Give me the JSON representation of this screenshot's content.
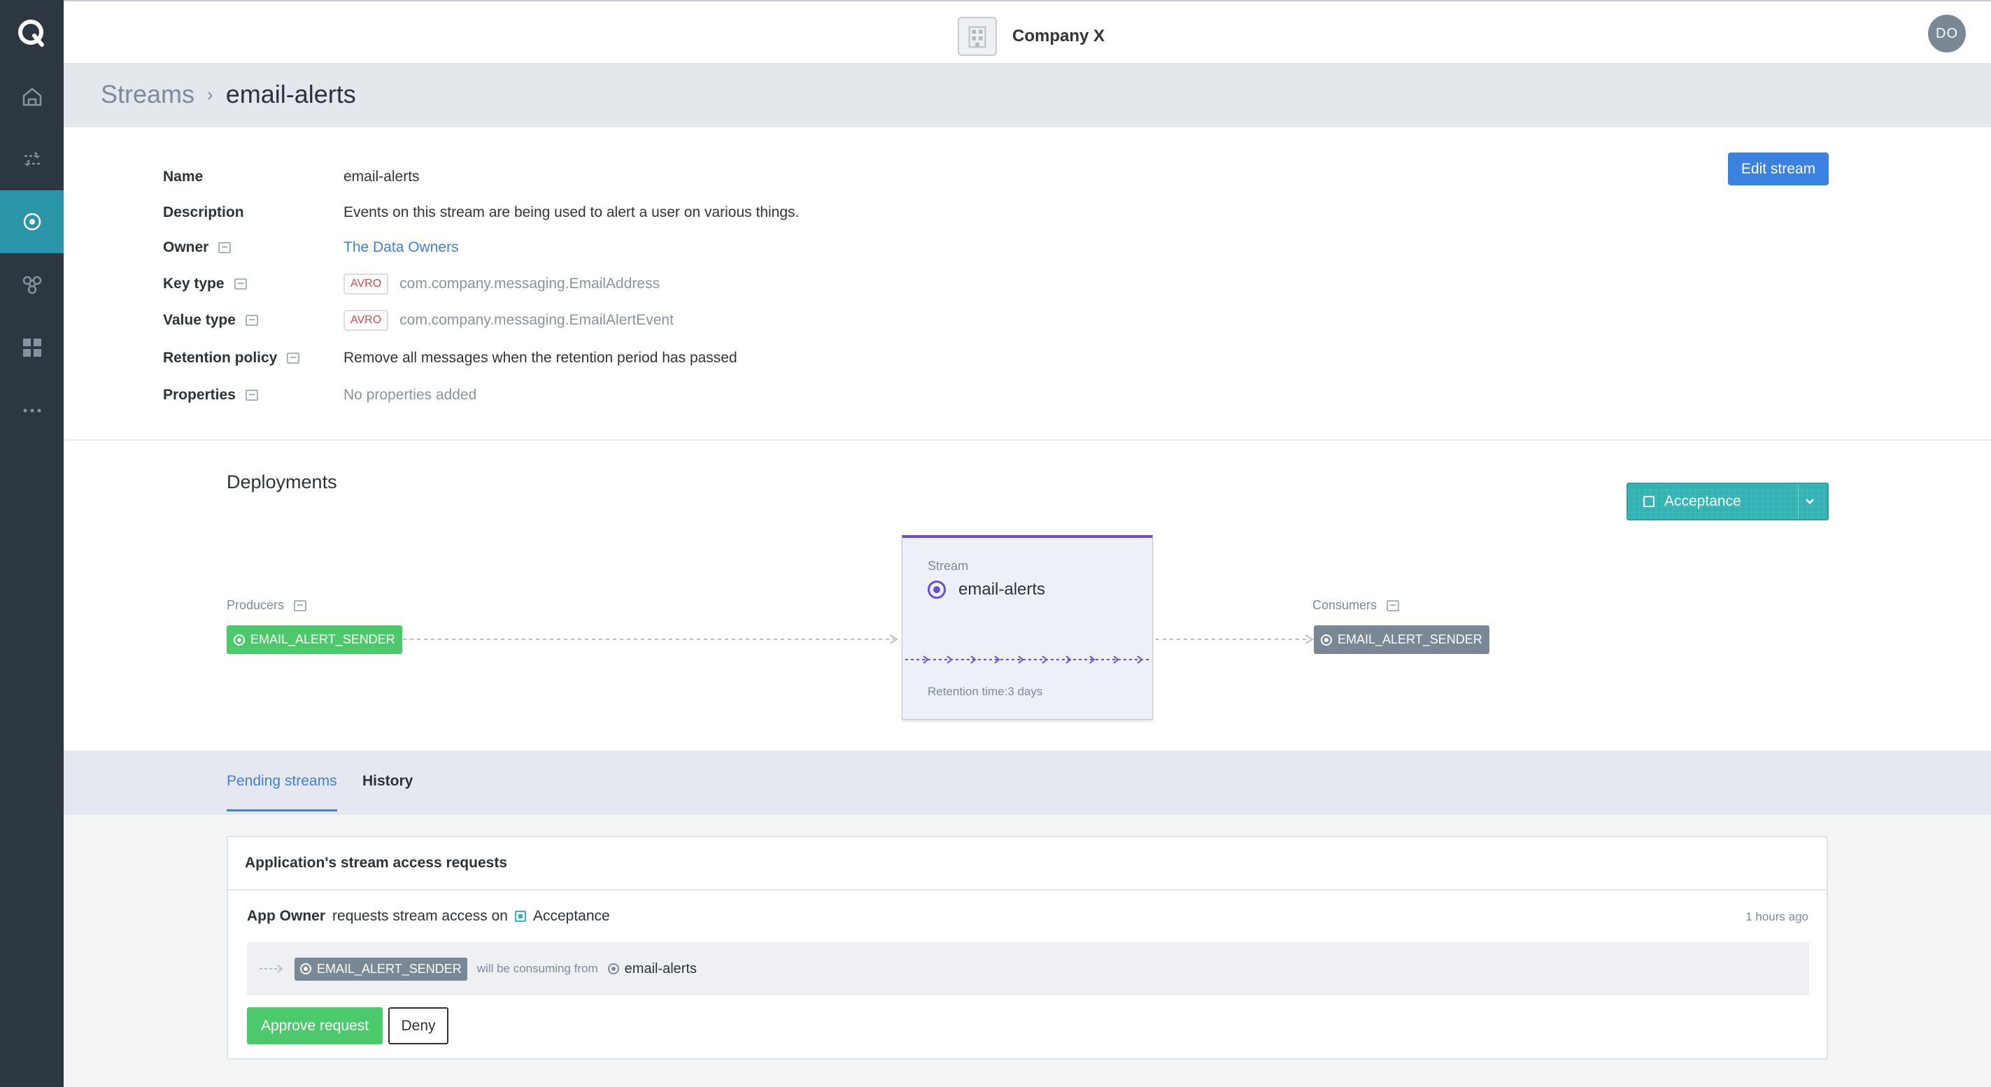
{
  "app": {
    "company_name": "Company X",
    "user_initials": "DO"
  },
  "sidebar": {
    "items": [
      {
        "name": "home-icon"
      },
      {
        "name": "exchange-icon"
      },
      {
        "name": "streams-icon",
        "active": true
      },
      {
        "name": "connections-icon"
      },
      {
        "name": "apps-grid-icon"
      },
      {
        "name": "more-icon"
      }
    ]
  },
  "breadcrumb": {
    "parent": "Streams",
    "separator": "›",
    "current": "email-alerts"
  },
  "details": {
    "edit_button": "Edit stream",
    "name_label": "Name",
    "name_value": "email-alerts",
    "description_label": "Description",
    "description_value": "Events on this stream are being used to alert a user on various things.",
    "owner_label": "Owner",
    "owner_value": "The Data Owners",
    "key_type_label": "Key type",
    "key_type_badge": "AVRO",
    "key_type_value": "com.company.messaging.EmailAddress",
    "value_type_label": "Value type",
    "value_type_badge": "AVRO",
    "value_type_value": "com.company.messaging.EmailAlertEvent",
    "retention_label": "Retention policy",
    "retention_value": "Remove all messages when the retention period has passed",
    "properties_label": "Properties",
    "properties_value": "No properties added"
  },
  "deployments": {
    "title": "Deployments",
    "environment": "Acceptance",
    "producers_label": "Producers",
    "producer": "EMAIL_ALERT_SENDER",
    "consumers_label": "Consumers",
    "consumer": "EMAIL_ALERT_SENDER",
    "stream_kind": "Stream",
    "stream_name": "email-alerts",
    "retention": "Retention time:3 days",
    "colors": {
      "producer": "#4cc96b",
      "consumer": "#7a8795",
      "stream": "#6b4fc9",
      "environment": "#33b3b3"
    }
  },
  "tabs": [
    {
      "label": "Pending streams",
      "active": true
    },
    {
      "label": "History",
      "active": false
    }
  ],
  "requests": {
    "panel_title": "Application's stream access requests",
    "requester": "App Owner",
    "action_text": "requests stream access on",
    "environment": "Acceptance",
    "time_ago": "1 hours ago",
    "app": "EMAIL_ALERT_SENDER",
    "relation": "will be consuming from",
    "stream": "email-alerts",
    "approve_button": "Approve request",
    "deny_button": "Deny"
  }
}
